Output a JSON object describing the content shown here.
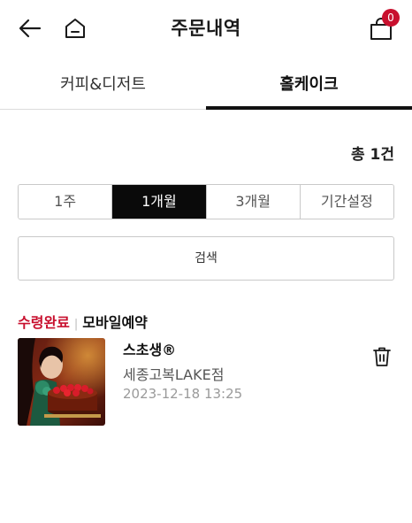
{
  "header": {
    "title": "주문내역",
    "cart_count": "0",
    "icons": {
      "back": "back-arrow-icon",
      "home": "home-icon",
      "cart": "shopping-bag-icon"
    },
    "badge_color": "#c8102e"
  },
  "tabs": [
    {
      "label": "커피&디저트",
      "active": false
    },
    {
      "label": "홀케이크",
      "active": true
    }
  ],
  "summary": {
    "total": "총 1건"
  },
  "period_filter": [
    {
      "label": "1주",
      "active": false
    },
    {
      "label": "1개월",
      "active": true
    },
    {
      "label": "3개월",
      "active": false
    },
    {
      "label": "기간설정",
      "active": false
    }
  ],
  "search_label": "검색",
  "orders": [
    {
      "status": "수령완료",
      "separator": "|",
      "order_type": "모바일예약",
      "product_name": "스초생®",
      "store": "세종고복LAKE점",
      "date": "2023-12-18 13:25",
      "icons": {
        "thumbnail": "product-photo",
        "delete": "trash-icon"
      }
    }
  ],
  "colors": {
    "accent": "#c8102e",
    "active_segment": "#0a0a0a"
  }
}
